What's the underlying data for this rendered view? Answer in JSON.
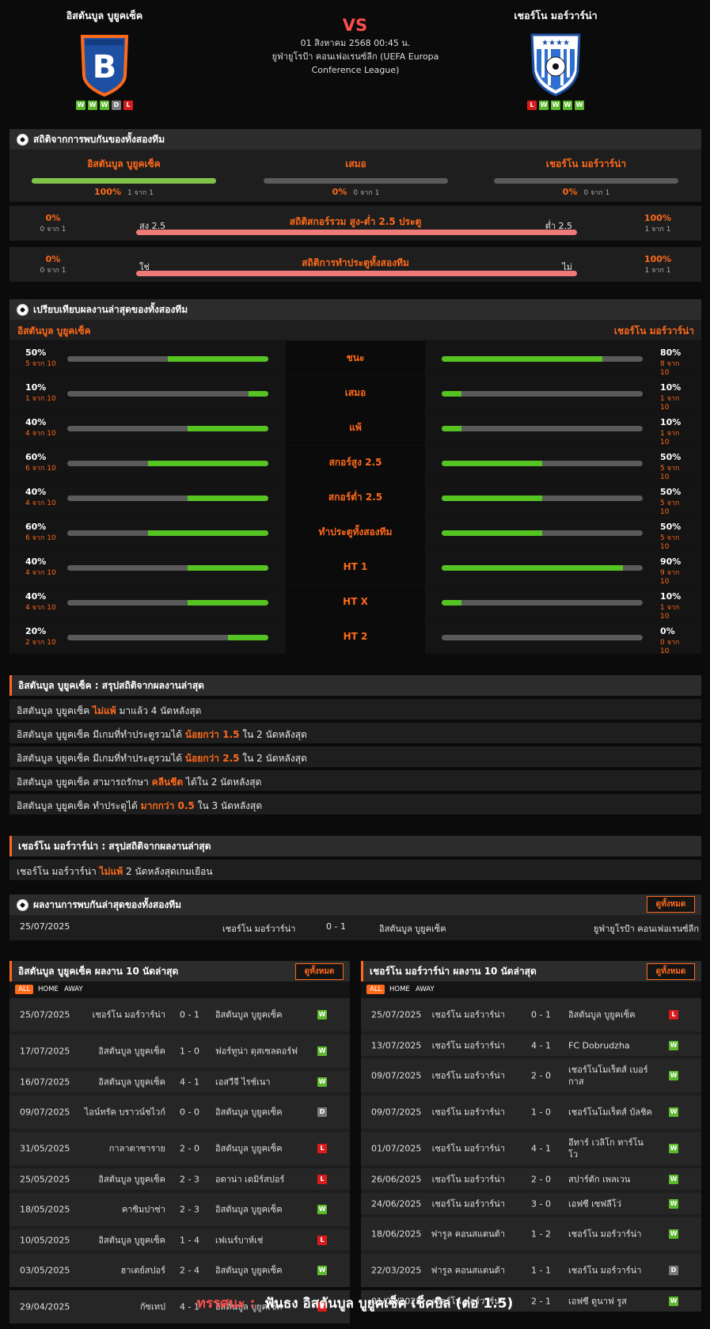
{
  "match": {
    "home": {
      "name": "อิสตันบูล บูยูคเซ็ค",
      "form": [
        "W",
        "W",
        "W",
        "D",
        "L"
      ]
    },
    "away": {
      "name": "เชอร์โน มอร์วาร์น่า",
      "form": [
        "L",
        "W",
        "W",
        "W",
        "W"
      ]
    },
    "vs": "VS",
    "date": "01 สิงหาคม 2568 00:45 น.",
    "competition": "ยูฟ่ายูโรป้า คอนเฟอเรนซ์ลีก (UEFA Europa Conference League)"
  },
  "h2h_stats": {
    "title": "สถิติจากการพบกันของทั้งสองทีม",
    "cols": [
      {
        "label": "อิสตันบูล บูยูคเซ็ค",
        "pct": "100%",
        "sub": "1 จาก 1",
        "fill": 1.0
      },
      {
        "label": "เสมอ",
        "pct": "0%",
        "sub": "0 จาก 1",
        "fill": 0
      },
      {
        "label": "เชอร์โน มอร์วาร์น่า",
        "pct": "0%",
        "sub": "0 จาก 1",
        "fill": 0
      }
    ]
  },
  "ou_stats": {
    "title": "สถิติสกอร์รวม สูง-ต่ำ 2.5 ประตู",
    "left_label": "สูง 2.5",
    "right_label": "ต่ำ 2.5",
    "left_pct": "0%",
    "left_sub": "0 จาก 1",
    "right_pct": "100%",
    "right_sub": "1 จาก 1"
  },
  "btts_stats": {
    "title": "สถิติการทำประตูทั้งสองทีม",
    "left_label": "ใช่",
    "right_label": "ไม่",
    "left_pct": "0%",
    "left_sub": "0 จาก 1",
    "right_pct": "100%",
    "right_sub": "1 จาก 1"
  },
  "compare": {
    "title": "เปรียบเทียบผลงานล่าสุดของทั้งสองทีม",
    "home": "อิสตันบูล บูยูคเซ็ค",
    "away": "เชอร์โน มอร์วาร์น่า",
    "rows": [
      {
        "label": "ชนะ",
        "l": "50%",
        "ls": "5 จาก 10",
        "lf": 0.5,
        "r": "80%",
        "rs": "8 จาก 10",
        "rf": 0.8
      },
      {
        "label": "เสมอ",
        "l": "10%",
        "ls": "1 จาก 10",
        "lf": 0.1,
        "r": "10%",
        "rs": "1 จาก 10",
        "rf": 0.1
      },
      {
        "label": "แพ้",
        "l": "40%",
        "ls": "4 จาก 10",
        "lf": 0.4,
        "r": "10%",
        "rs": "1 จาก 10",
        "rf": 0.1
      },
      {
        "label": "สกอร์สูง 2.5",
        "l": "60%",
        "ls": "6 จาก 10",
        "lf": 0.6,
        "r": "50%",
        "rs": "5 จาก 10",
        "rf": 0.5
      },
      {
        "label": "สกอร์ต่ำ 2.5",
        "l": "40%",
        "ls": "4 จาก 10",
        "lf": 0.4,
        "r": "50%",
        "rs": "5 จาก 10",
        "rf": 0.5
      },
      {
        "label": "ทำประตูทั้งสองทีม",
        "l": "60%",
        "ls": "6 จาก 10",
        "lf": 0.6,
        "r": "50%",
        "rs": "5 จาก 10",
        "rf": 0.5
      },
      {
        "label": "HT 1",
        "l": "40%",
        "ls": "4 จาก 10",
        "lf": 0.4,
        "r": "90%",
        "rs": "9 จาก 10",
        "rf": 0.9
      },
      {
        "label": "HT X",
        "l": "40%",
        "ls": "4 จาก 10",
        "lf": 0.4,
        "r": "10%",
        "rs": "1 จาก 10",
        "rf": 0.1
      },
      {
        "label": "HT 2",
        "l": "20%",
        "ls": "2 จาก 10",
        "lf": 0.2,
        "r": "0%",
        "rs": "0 จาก 10",
        "rf": 0
      }
    ]
  },
  "home_summary": {
    "title": "อิสตันบูล บูยูคเซ็ค : สรุปสถิติจากผลงานล่าสุด",
    "rows": [
      [
        "อิสตันบูล บูยูคเซ็ค ",
        "ไม่แพ้",
        " มาแล้ว 4 นัดหลังสุด"
      ],
      [
        "อิสตันบูล บูยูคเซ็ค  มีเกมที่ทำประตูรวมได้ ",
        "น้อยกว่า  1.5",
        "  ใน 2 นัดหลังสุด"
      ],
      [
        "อิสตันบูล บูยูคเซ็ค  มีเกมที่ทำประตูรวมได้ ",
        "น้อยกว่า  2.5",
        "  ใน 2 นัดหลังสุด"
      ],
      [
        "อิสตันบูล บูยูคเซ็ค  สามารถรักษา ",
        "คลีนชีต",
        " ได้ใน 2 นัดหลังสุด"
      ],
      [
        "อิสตันบูล บูยูคเซ็ค  ทำประตูได้ ",
        "มากกว่า  0.5",
        "  ใน 3 นัดหลังสุด"
      ]
    ]
  },
  "away_summary": {
    "title": "เชอร์โน มอร์วาร์น่า : สรุปสถิติจากผลงานล่าสุด",
    "rows": [
      [
        "เชอร์โน มอร์วาร์น่า ",
        "ไม่แพ้",
        "  2  นัดหลังสุดเกมเยือน"
      ]
    ]
  },
  "h2h_results": {
    "title": "ผลงานการพบกันล่าสุดของทั้งสองทีม",
    "view_all": "ดูทั้งหมด",
    "rows": [
      {
        "date": "25/07/2025",
        "home": "เชอร์โน มอร์วาร์น่า",
        "score": "0 - 1",
        "away": "อิสตันบูล บูยูคเซ็ค",
        "comp": "ยูฟ่ายูโรป้า คอนเฟอเรนซ์ลีก"
      }
    ]
  },
  "home_last10": {
    "title": "อิสตันบูล บูยูคเซ็ค ผลงาน 10 นัดล่าสุด",
    "view_all": "ดูทั้งหมด",
    "tabs": [
      "ALL",
      "HOME",
      "AWAY"
    ],
    "rows": [
      {
        "date": "25/07/2025",
        "home": "เชอร์โน มอร์วาร์น่า",
        "score": "0 - 1",
        "away": "อิสตันบูล บูยูคเซ็ค",
        "res": "W"
      },
      {
        "date": "17/07/2025",
        "home": "อิสตันบูล บูยูคเซ็ค",
        "score": "1 - 0",
        "away": "ฟอร์ทูน่า ดุสเซลดอร์ฟ",
        "res": "W"
      },
      {
        "date": "16/07/2025",
        "home": "อิสตันบูล บูยูคเซ็ค",
        "score": "4 - 1",
        "away": "เอสวีจี ไรช์เนา",
        "res": "W"
      },
      {
        "date": "09/07/2025",
        "home": "ไอน์ทรัค บราวน์ชไวก์",
        "score": "0 - 0",
        "away": "อิสตันบูล บูยูคเซ็ค",
        "res": "D"
      },
      {
        "date": "31/05/2025",
        "home": "กาลาตาซาราย",
        "score": "2 - 0",
        "away": "อิสตันบูล บูยูคเซ็ค",
        "res": "L"
      },
      {
        "date": "25/05/2025",
        "home": "อิสตันบูล บูยูคเซ็ค",
        "score": "2 - 3",
        "away": "อดาน่า เดมิร์สปอร์",
        "res": "L"
      },
      {
        "date": "18/05/2025",
        "home": "คาซิมปาซ่า",
        "score": "2 - 3",
        "away": "อิสตันบูล บูยูคเซ็ค",
        "res": "W"
      },
      {
        "date": "10/05/2025",
        "home": "อิสตันบูล บูยูคเซ็ค",
        "score": "1 - 4",
        "away": "เฟเนร์บาห์เช่",
        "res": "L"
      },
      {
        "date": "03/05/2025",
        "home": "ฮาเตย์สปอร์",
        "score": "2 - 4",
        "away": "อิสตันบูล บูยูคเซ็ค",
        "res": "W"
      },
      {
        "date": "29/04/2025",
        "home": "กัซเทป",
        "score": "4 - 1",
        "away": "อิสตันบูล บูยูคเซ็ค",
        "res": "L"
      }
    ]
  },
  "away_last10": {
    "title": "เชอร์โน มอร์วาร์น่า ผลงาน 10 นัดล่าสุด",
    "view_all": "ดูทั้งหมด",
    "tabs": [
      "ALL",
      "HOME",
      "AWAY"
    ],
    "rows": [
      {
        "date": "25/07/2025",
        "home": "เชอร์โน มอร์วาร์น่า",
        "score": "0 - 1",
        "away": "อิสตันบูล บูยูคเซ็ค",
        "res": "L"
      },
      {
        "date": "13/07/2025",
        "home": "เชอร์โน มอร์วาร์น่า",
        "score": "4 - 1",
        "away": "FC Dobrudzha",
        "res": "W"
      },
      {
        "date": "09/07/2025",
        "home": "เชอร์โน มอร์วาร์น่า",
        "score": "2 - 0",
        "away": "เชอร์โนโมเร็ตส์ เบอร์กาส",
        "res": "W"
      },
      {
        "date": "09/07/2025",
        "home": "เชอร์โน มอร์วาร์น่า",
        "score": "1 - 0",
        "away": "เชอร์โนโมเร็ตส์ บัลชิค",
        "res": "W"
      },
      {
        "date": "01/07/2025",
        "home": "เชอร์โน มอร์วาร์น่า",
        "score": "4 - 1",
        "away": "อีทาร์ เวลิโก ทาร์โนโว",
        "res": "W"
      },
      {
        "date": "26/06/2025",
        "home": "เชอร์โน มอร์วาร์น่า",
        "score": "2 - 0",
        "away": "สปาร์ตัก เพลเวน",
        "res": "W"
      },
      {
        "date": "24/06/2025",
        "home": "เชอร์โน มอร์วาร์น่า",
        "score": "3 - 0",
        "away": "เอฟซี เซฟลีโว่",
        "res": "W"
      },
      {
        "date": "18/06/2025",
        "home": "ฟารูล คอนสแตนต้า",
        "score": "1 - 2",
        "away": "เชอร์โน มอร์วาร์น่า",
        "res": "W"
      },
      {
        "date": "22/03/2025",
        "home": "ฟารูล คอนสแตนต้า",
        "score": "1 - 1",
        "away": "เชอร์โน มอร์วาร์น่า",
        "res": "D"
      },
      {
        "date": "01/02/2025",
        "home": "เชอร์โน มอร์วาร์น่า",
        "score": "2 - 1",
        "away": "เอฟซี ดูนาฟ รูส",
        "res": "W"
      }
    ]
  },
  "verdict": {
    "label": "ทรรศนะ :",
    "text": "ฟันธง อิสตันบูล บูยูคเซ็ค เช็คบิล (ต่อ 1.5)"
  },
  "icons": {
    "section": "soccer-ball-icon"
  },
  "colors": {
    "accent": "#ff6a1a",
    "win": "#5cb82c",
    "loss": "#d81c1c",
    "draw": "#7a7a7a"
  }
}
